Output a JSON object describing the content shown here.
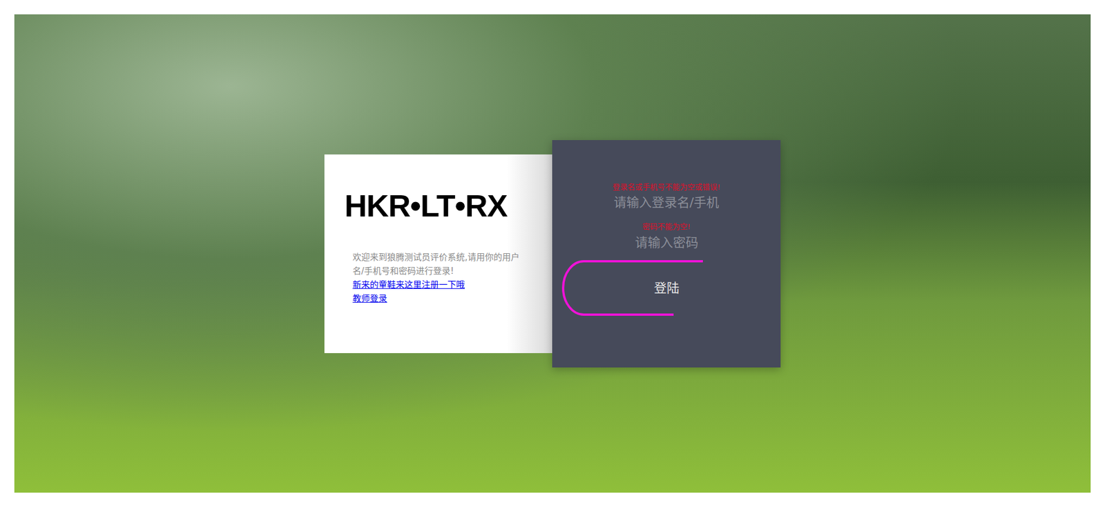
{
  "logo": {
    "text": "HKR•LT•RX"
  },
  "intro": {
    "text": "欢迎来到狼腾测试员评价系统,请用你的用户名/手机号和密码进行登录!"
  },
  "links": [
    {
      "label": "新来的童鞋来这里注册一下哦"
    },
    {
      "label": "教师登录"
    }
  ],
  "form": {
    "fields": [
      {
        "error": "登录名或手机号不能为空或错误!",
        "placeholder": "请输入登录名/手机"
      },
      {
        "error": "密码不能为空!",
        "placeholder": "请输入密码"
      }
    ],
    "button": "登陆"
  }
}
